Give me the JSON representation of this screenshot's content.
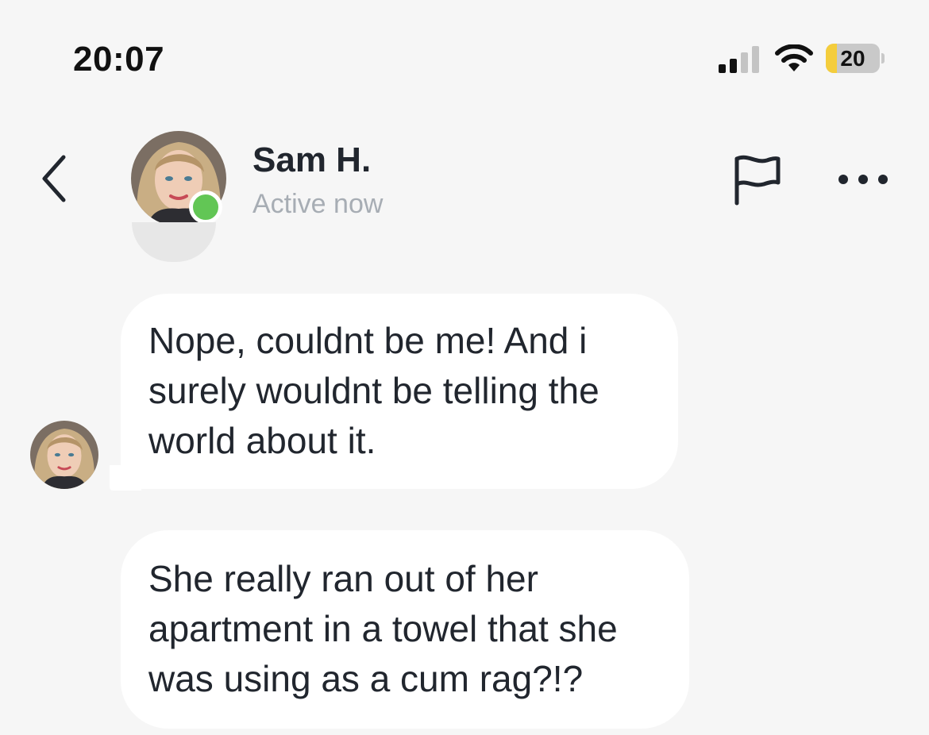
{
  "status_bar": {
    "time": "20:07",
    "battery_level": "20",
    "battery_fraction": 0.2,
    "icons": [
      "signal-icon",
      "wifi-icon",
      "battery-icon"
    ],
    "battery_color": "#f4cd3c"
  },
  "header": {
    "contact_name": "Sam H.",
    "contact_status": "Active now",
    "online_color": "#62c655",
    "icons": [
      "back-chevron-icon",
      "flag-icon",
      "more-dots-icon"
    ]
  },
  "messages": [
    {
      "lines": [
        "Nope, couldnt be me! And i",
        "surely wouldnt be telling the",
        "world about it."
      ]
    },
    {
      "lines": [
        "She really ran out of her",
        "apartment in a towel that she",
        "was using as a cum rag?!?"
      ]
    }
  ]
}
